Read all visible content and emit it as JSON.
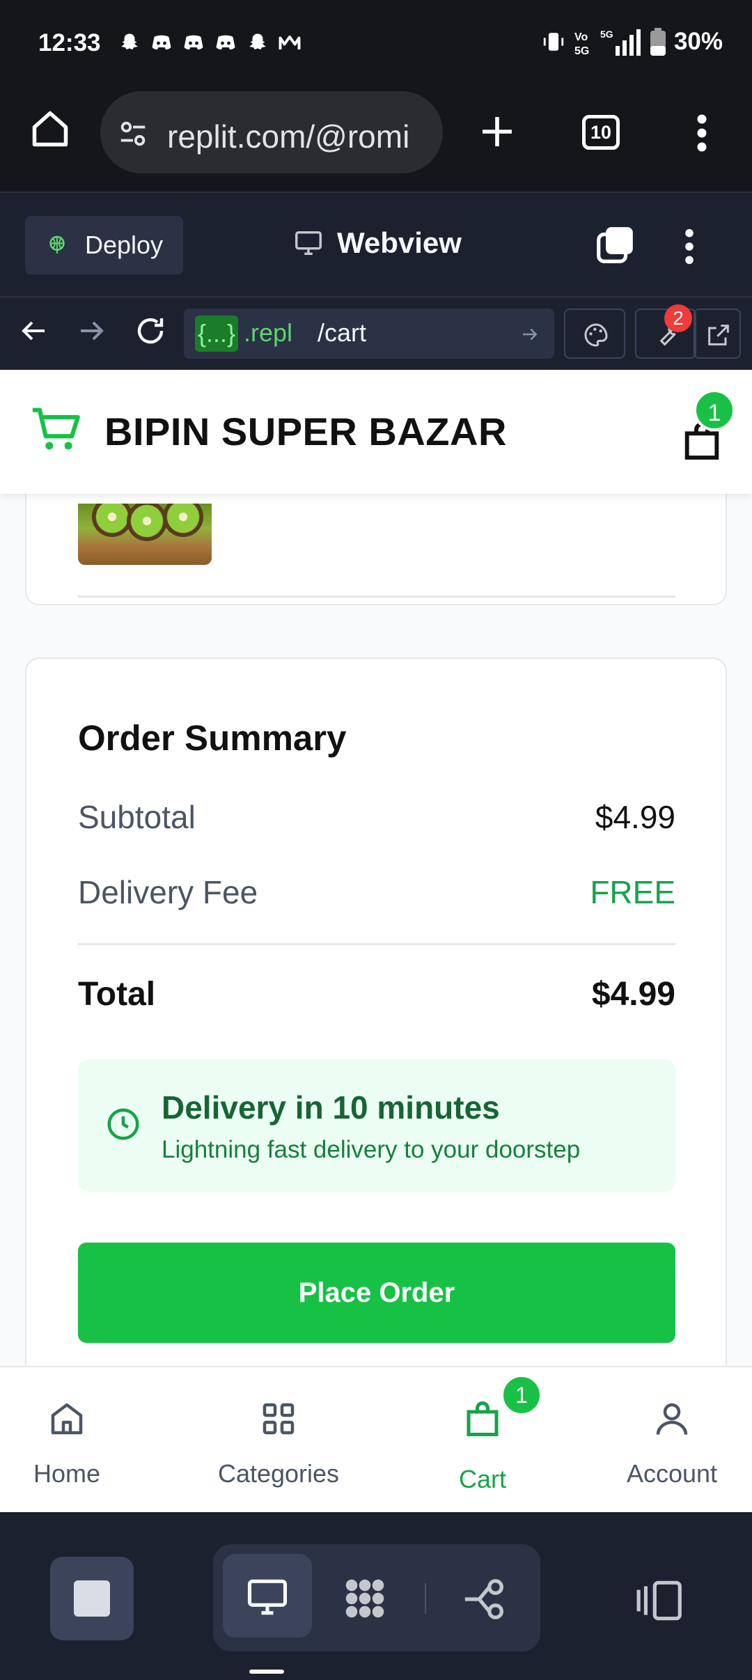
{
  "status_bar": {
    "time": "12:33",
    "battery": "30%",
    "network": "5G"
  },
  "browser": {
    "url": "replit.com/@romi",
    "tab_count": "10"
  },
  "replit": {
    "deploy_label": "Deploy",
    "view_label": "Webview",
    "url_tag": "{...}",
    "url_suffix": ".repl",
    "url_path": "/cart",
    "devtools_badge": "2"
  },
  "store": {
    "brand": "BIPIN SUPER BAZAR",
    "cart_count": "1"
  },
  "order_summary": {
    "title": "Order Summary",
    "subtotal_label": "Subtotal",
    "subtotal_value": "$4.99",
    "delivery_label": "Delivery Fee",
    "delivery_value": "FREE",
    "total_label": "Total",
    "total_value": "$4.99",
    "delivery_title": "Delivery in 10 minutes",
    "delivery_subtitle": "Lightning fast delivery to your doorstep",
    "place_order": "Place Order"
  },
  "bottom_nav": {
    "items": [
      {
        "label": "Home",
        "icon": "home-icon"
      },
      {
        "label": "Categories",
        "icon": "grid-icon"
      },
      {
        "label": "Cart",
        "icon": "bag-icon",
        "badge": "1",
        "active": true
      },
      {
        "label": "Account",
        "icon": "user-icon"
      }
    ]
  },
  "colors": {
    "accent": "#16c146",
    "replit_bg": "#1c2130",
    "chrome_bg": "#151619"
  }
}
